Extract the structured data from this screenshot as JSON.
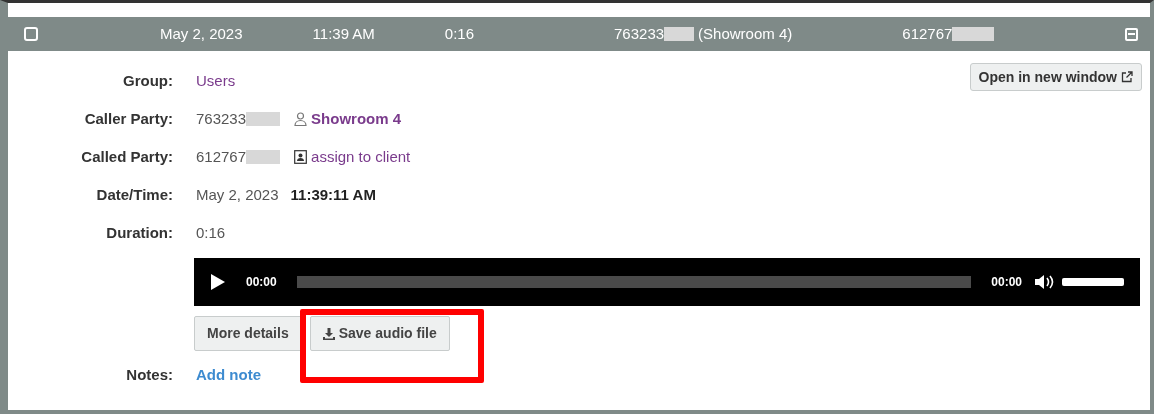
{
  "header": {
    "checked": false,
    "date": "May 2, 2023",
    "time": "11:39 AM",
    "duration": "0:16",
    "caller": "763233",
    "caller_name": "(Showroom 4)",
    "called": "612767",
    "expanded": true
  },
  "open_button": "Open in new window",
  "fields": [
    {
      "kind": "link",
      "label": "Group:",
      "value": "Users"
    },
    {
      "kind": "caller",
      "label": "Caller Party:",
      "value": "763233",
      "link": "Showroom 4"
    },
    {
      "kind": "called",
      "label": "Called Party:",
      "value": "612767",
      "link": "assign to client"
    },
    {
      "kind": "datetime",
      "label": "Date/Time:",
      "value": "May 2, 2023",
      "extra": "11:39:11 AM"
    },
    {
      "kind": "text",
      "label": "Duration:",
      "value": "0:16"
    }
  ],
  "player": {
    "current": "00:00",
    "total": "00:00",
    "volume": {
      "level": 1
    }
  },
  "buttons": [
    "More details",
    "Save audio file"
  ],
  "notes": {
    "label": "Notes:",
    "link": "Add note"
  }
}
